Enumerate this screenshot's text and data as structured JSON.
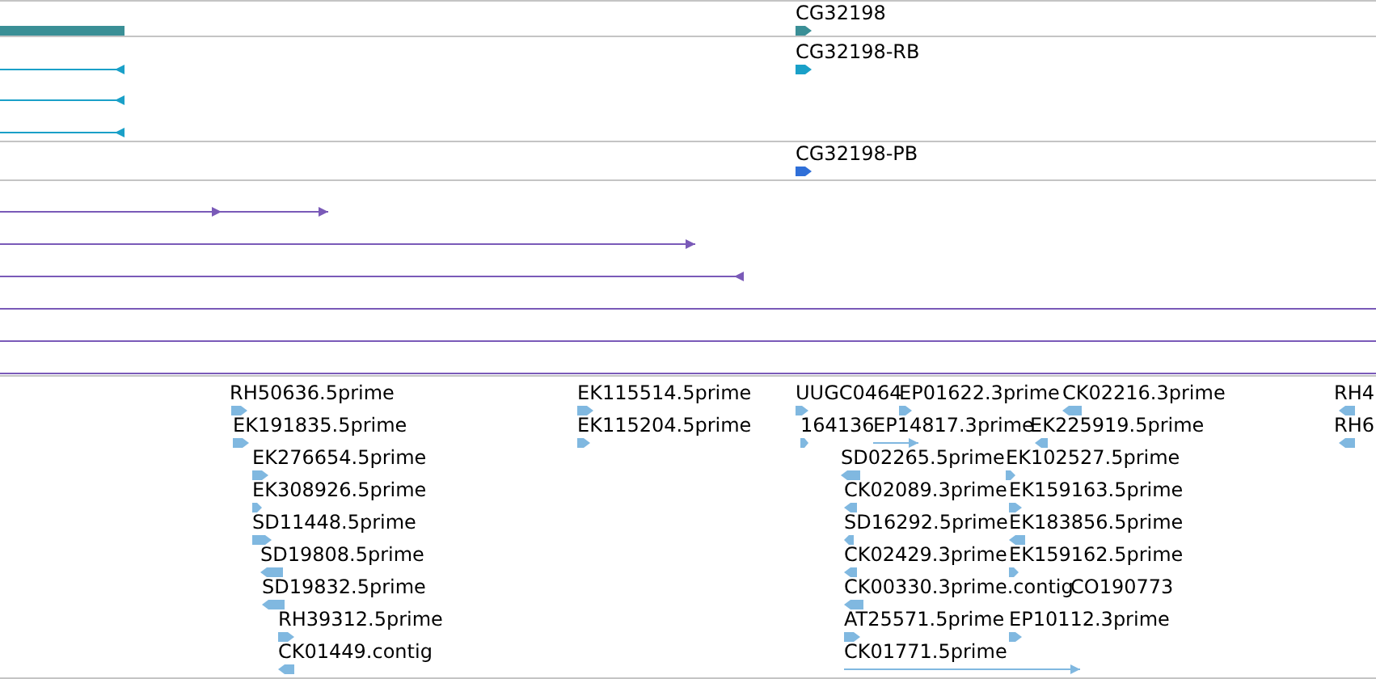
{
  "tracks": [
    {
      "color": "#3a8f96",
      "features": [
        {
          "kind": "bar"
        },
        {
          "kind": "block",
          "label": "CG32198",
          "reverse": false
        }
      ]
    },
    {
      "color": "#1aa0c8",
      "features": [
        {
          "kind": "line",
          "reverse": true
        },
        {
          "kind": "line",
          "reverse": true
        },
        {
          "kind": "line",
          "reverse": true
        },
        {
          "kind": "block",
          "label": "CG32198-RB",
          "reverse": false
        }
      ]
    },
    {
      "color": "#2f6fd8",
      "features": [
        {
          "kind": "block",
          "label": "CG32198-PB",
          "reverse": false
        }
      ]
    },
    {
      "color": "#7a5ab8",
      "features": [
        {
          "kind": "line",
          "reverse": false
        },
        {
          "kind": "line",
          "reverse": false
        },
        {
          "kind": "line",
          "reverse": false
        },
        {
          "kind": "line",
          "reverse": true
        },
        {
          "kind": "line"
        },
        {
          "kind": "line"
        },
        {
          "kind": "line"
        }
      ]
    },
    {
      "color": "#80b8e0",
      "features": [
        {
          "kind": "block",
          "label": "RH50636.5prime",
          "reverse": false
        },
        {
          "kind": "block",
          "label": "EK191835.5prime",
          "reverse": false
        },
        {
          "kind": "block",
          "label": "EK276654.5prime",
          "reverse": false
        },
        {
          "kind": "block",
          "label": "EK308926.5prime",
          "reverse": false
        },
        {
          "kind": "block",
          "label": "SD11448.5prime",
          "reverse": false
        },
        {
          "kind": "block",
          "label": "SD19808.5prime",
          "reverse": true
        },
        {
          "kind": "block",
          "label": "SD19832.5prime",
          "reverse": true
        },
        {
          "kind": "block",
          "label": "RH39312.5prime",
          "reverse": false
        },
        {
          "kind": "block",
          "label": "CK01449.contig",
          "reverse": true
        },
        {
          "kind": "block",
          "label": "EK115514.5prime",
          "reverse": false
        },
        {
          "kind": "block",
          "label": "EK115204.5prime",
          "reverse": false
        },
        {
          "kind": "block",
          "label": "UUGC0464",
          "reverse": false
        },
        {
          "kind": "block",
          "label": "EP01622.3prime",
          "reverse": false
        },
        {
          "kind": "block",
          "label": "CK02216.3prime",
          "reverse": true
        },
        {
          "kind": "block",
          "label": "164136",
          "reverse": false
        },
        {
          "kind": "line",
          "label": "EP14817.3prime",
          "reverse": false
        },
        {
          "kind": "block",
          "label": "EK225919.5prime",
          "reverse": true
        },
        {
          "kind": "block",
          "label": "SD02265.5prime",
          "reverse": true
        },
        {
          "kind": "block",
          "label": "EK102527.5prime",
          "reverse": false
        },
        {
          "kind": "block",
          "label": "CK02089.3prime",
          "reverse": true
        },
        {
          "kind": "block",
          "label": "EK159163.5prime",
          "reverse": false
        },
        {
          "kind": "block",
          "label": "SD16292.5prime",
          "reverse": true
        },
        {
          "kind": "block",
          "label": "EK183856.5prime",
          "reverse": true
        },
        {
          "kind": "block",
          "label": "CK02429.3prime",
          "reverse": true
        },
        {
          "kind": "block",
          "label": "EK159162.5prime",
          "reverse": false
        },
        {
          "kind": "block",
          "label": "CK00330.3prime.contig",
          "reverse": true
        },
        {
          "label": "CO190773"
        },
        {
          "kind": "block",
          "label": "AT25571.5prime",
          "reverse": false
        },
        {
          "kind": "block",
          "label": "EP10112.3prime",
          "reverse": false
        },
        {
          "kind": "line",
          "label": "CK01771.5prime",
          "reverse": false
        },
        {
          "kind": "block",
          "label": "RH4",
          "reverse": true
        },
        {
          "kind": "block",
          "label": "RH6",
          "reverse": true
        }
      ]
    }
  ]
}
